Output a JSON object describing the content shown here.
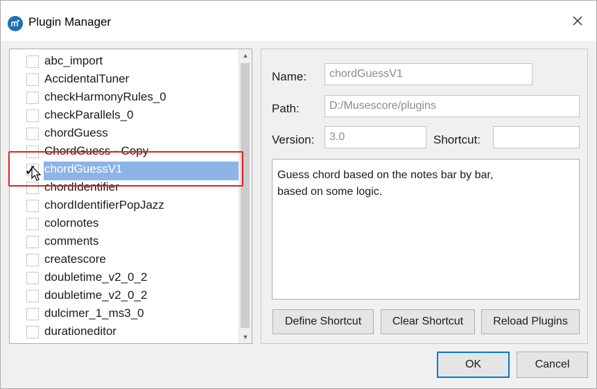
{
  "window": {
    "title": "Plugin Manager",
    "close_glyph": "✕",
    "app_icon": "musescore-logo-icon"
  },
  "plugins": {
    "items": [
      {
        "label": "abc_import",
        "checked": false
      },
      {
        "label": "AccidentalTuner",
        "checked": false
      },
      {
        "label": "checkHarmonyRules_0",
        "checked": false
      },
      {
        "label": "checkParallels_0",
        "checked": false
      },
      {
        "label": "chordGuess",
        "checked": false
      },
      {
        "label": "ChordGuess - Copy",
        "checked": false
      },
      {
        "label": "chordGuessV1",
        "checked": true,
        "selected": true
      },
      {
        "label": "chordIdentifier",
        "checked": false
      },
      {
        "label": "chordIdentifierPopJazz",
        "checked": false
      },
      {
        "label": "colornotes",
        "checked": false
      },
      {
        "label": "comments",
        "checked": false
      },
      {
        "label": "createscore",
        "checked": false
      },
      {
        "label": "doubletime_v2_0_2",
        "checked": false
      },
      {
        "label": "doubletime_v2_0_2",
        "checked": false
      },
      {
        "label": "dulcimer_1_ms3_0",
        "checked": false
      },
      {
        "label": "durationeditor",
        "checked": false
      }
    ],
    "checkmark": "✓"
  },
  "details": {
    "name_label": "Name:",
    "name_value": "chordGuessV1",
    "path_label": "Path:",
    "path_value": "D:/Musescore/plugins",
    "version_label": "Version:",
    "version_value": "3.0",
    "shortcut_label": "Shortcut:",
    "shortcut_value": "",
    "description_line1": "Guess chord based on the notes bar by bar,",
    "description_line2": "based on some logic."
  },
  "buttons": {
    "define_shortcut": "Define Shortcut",
    "clear_shortcut": "Clear Shortcut",
    "reload_plugins": "Reload Plugins",
    "ok": "OK",
    "cancel": "Cancel"
  },
  "colors": {
    "selection": "#8cb4e8",
    "highlight": "#e02020",
    "accent": "#0078d7"
  }
}
